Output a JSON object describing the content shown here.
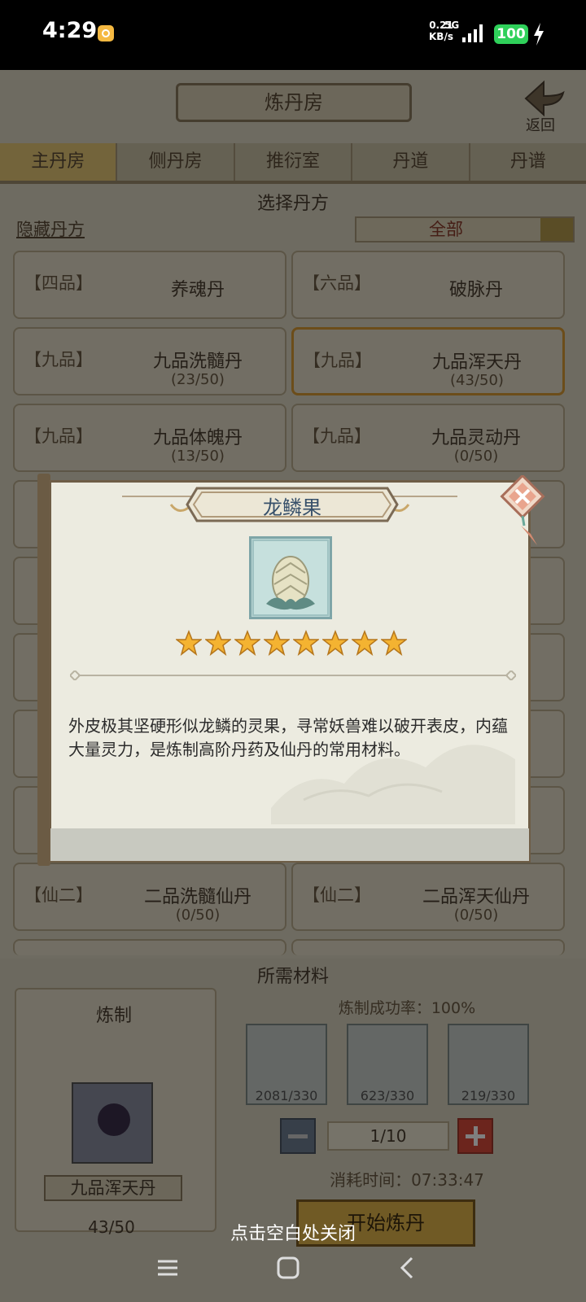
{
  "status_bar": {
    "time": "4:29",
    "net_speed_value": "0.21",
    "net_speed_unit": "KB/s",
    "network": "5G",
    "battery": "100"
  },
  "game": {
    "title": "炼丹房",
    "back_label": "返回",
    "tabs": [
      "主丹房",
      "侧丹房",
      "推衍室",
      "丹道",
      "丹谱"
    ],
    "active_tab": 0,
    "section_title": "选择丹方",
    "hide_recipes": "隐藏丹方",
    "filter_value": "全部",
    "recipes": [
      {
        "grade": "【四品】",
        "name": "养魂丹",
        "progress": ""
      },
      {
        "grade": "【六品】",
        "name": "破脉丹",
        "progress": ""
      },
      {
        "grade": "【九品】",
        "name": "九品洗髓丹",
        "progress": "(23/50)"
      },
      {
        "grade": "【九品】",
        "name": "九品浑天丹",
        "progress": "(43/50)"
      },
      {
        "grade": "【九品】",
        "name": "九品体魄丹",
        "progress": "(13/50)"
      },
      {
        "grade": "【九品】",
        "name": "九品灵动丹",
        "progress": "(0/50)"
      },
      {
        "grade": "【仙二】",
        "name": "二品洗髓仙丹",
        "progress": "(0/50)"
      },
      {
        "grade": "【仙二】",
        "name": "二品浑天仙丹",
        "progress": "(0/50)"
      }
    ],
    "materials_title": "所需材料",
    "refine_label": "炼制",
    "success_rate": "炼制成功率：100%",
    "materials": [
      "2081/330",
      "623/330",
      "219/330"
    ],
    "quantity": "1/10",
    "time_cost": "消耗时间：07:33:47",
    "selected_pill": "九品浑天丹",
    "selected_progress": "43/50",
    "start_button": "开始炼丹"
  },
  "modal": {
    "title": "龙鳞果",
    "item_icon": "dragon-scale-fruit-icon",
    "stars": 8,
    "description": "外皮极其坚硬形似龙鳞的灵果，寻常妖兽难以破开表皮，内蕴大量灵力，是炼制高阶丹药及仙丹的常用材料。"
  },
  "close_hint": "点击空白处关闭",
  "colors": {
    "accent_orange": "#d99a34",
    "star": "#f4b331",
    "battery": "#2fd05a"
  }
}
